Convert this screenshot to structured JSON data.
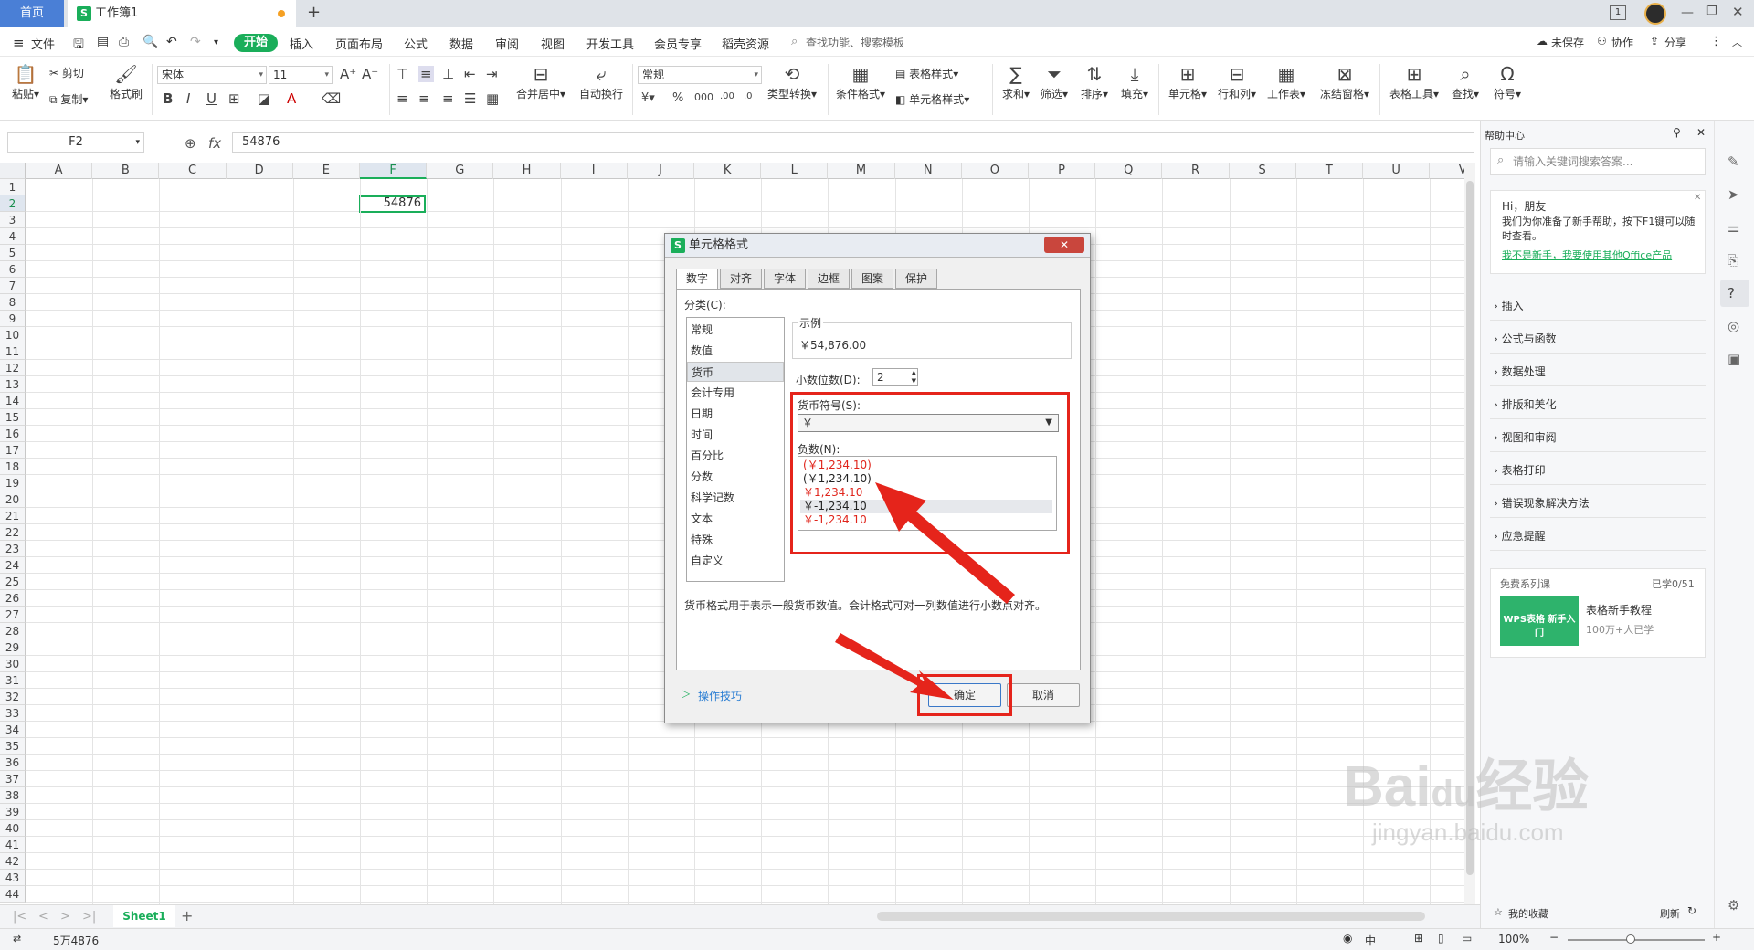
{
  "titlebar": {
    "home_tab": "首页",
    "doc_tab": "工作簿1",
    "new_tab": "+"
  },
  "menubar": {
    "file": "文件",
    "tabs": [
      "开始",
      "插入",
      "页面布局",
      "公式",
      "数据",
      "审阅",
      "视图",
      "开发工具",
      "会员专享",
      "稻壳资源"
    ],
    "search_placeholder": "查找功能、搜索模板",
    "right": [
      "未保存",
      "协作",
      "分享"
    ]
  },
  "ribbon": {
    "cut": "剪切",
    "paste": "粘贴",
    "copy": "复制",
    "format_painter": "格式刷",
    "font_name": "宋体",
    "font_size": "11",
    "number_format": "常规",
    "merge": "合并居中",
    "wrap": "自动换行",
    "type_convert": "类型转换",
    "cond_format": "条件格式",
    "table_style": "表格样式",
    "cell_style": "单元格样式",
    "sum": "求和",
    "filter": "筛选",
    "sort": "排序",
    "fill": "填充",
    "cell": "单元格",
    "rowcol": "行和列",
    "worksheet": "工作表",
    "freeze": "冻结窗格",
    "table_tools": "表格工具",
    "find": "查找",
    "symbol": "符号"
  },
  "formulabar": {
    "name_box": "F2",
    "fx": "fx",
    "value": "54876"
  },
  "sheet": {
    "columns": [
      "A",
      "B",
      "C",
      "D",
      "E",
      "F",
      "G",
      "H",
      "I",
      "J",
      "K",
      "L",
      "M",
      "N",
      "O",
      "P",
      "Q",
      "R",
      "S",
      "T",
      "U",
      "V"
    ],
    "selected_col": "F",
    "selected_row": 2,
    "cell_value": "54876",
    "row_count": 44
  },
  "sheettabs": {
    "sheet1": "Sheet1",
    "add": "+"
  },
  "statusbar": {
    "left": "5万4876",
    "lang": "中",
    "zoom": "100%"
  },
  "help": {
    "title": "帮助中心",
    "search_placeholder": "请输入关键词搜索答案...",
    "greeting": "Hi，朋友",
    "intro": "我们为你准备了新手帮助，按下F1键可以随时查看。",
    "link": "我不是新手，我要使用其他Office产品",
    "items": [
      "插入",
      "公式与函数",
      "数据处理",
      "排版和美化",
      "视图和审阅",
      "表格打印",
      "错误现象解决方法",
      "应急提醒"
    ],
    "course_label": "免费系列课",
    "course_progress": "已学0/51",
    "course_thumb": "WPS表格 新手入门",
    "course_title": "表格新手教程",
    "course_sub": "100万+人已学",
    "favorites": "我的收藏",
    "refresh": "刷新"
  },
  "dialog": {
    "title": "单元格格式",
    "tabs": [
      "数字",
      "对齐",
      "字体",
      "边框",
      "图案",
      "保护"
    ],
    "category_label": "分类(C):",
    "categories": [
      "常规",
      "数值",
      "货币",
      "会计专用",
      "日期",
      "时间",
      "百分比",
      "分数",
      "科学记数",
      "文本",
      "特殊",
      "自定义"
    ],
    "selected_category": "货币",
    "sample_label": "示例",
    "sample_value": "￥54,876.00",
    "decimal_label": "小数位数(D):",
    "decimal_value": "2",
    "currency_label": "货币符号(S):",
    "currency_value": "￥",
    "negative_label": "负数(N):",
    "negatives": [
      {
        "text": "(￥1,234.10)",
        "color": "#e0241b"
      },
      {
        "text": "(￥1,234.10)",
        "color": "#222222"
      },
      {
        "text": "￥1,234.10",
        "color": "#e0241b"
      },
      {
        "text": "￥-1,234.10",
        "color": "#222222"
      },
      {
        "text": "￥-1,234.10",
        "color": "#e0241b"
      }
    ],
    "description": "货币格式用于表示一般货币数值。会计格式可对一列数值进行小数点对齐。",
    "tips": "操作技巧",
    "ok": "确定",
    "cancel": "取消"
  },
  "colors": {
    "accent_green": "#1aae5a",
    "annotation_red": "#e5241b"
  },
  "watermark": "Baidu经验 jingyan.baidu.com"
}
